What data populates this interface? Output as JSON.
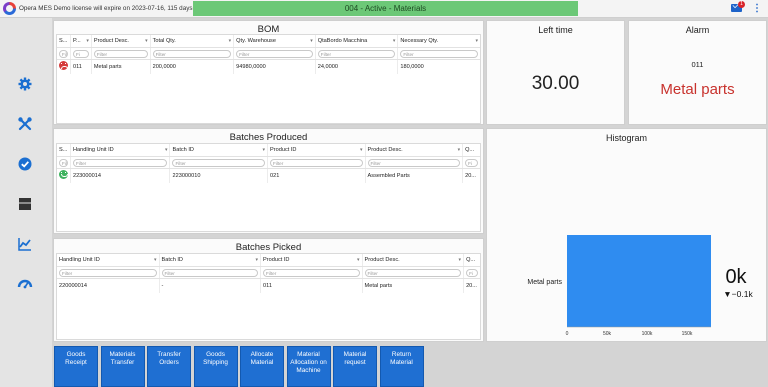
{
  "topbar": {
    "license_text": "Opera MES Demo license will expire on 2023-07-16, 115 days left",
    "status": "004 - Active - Materials",
    "mail_badge": "1",
    "menu_icon": "kebab-menu-icon",
    "logo_icon": "app-logo-icon"
  },
  "sidebar": {
    "icons": [
      "settings-gear-icon",
      "tools-icon",
      "check-circle-icon",
      "package-icon",
      "trend-chart-icon",
      "dashboard-gauge-icon"
    ]
  },
  "bom": {
    "title": "BOM",
    "columns": [
      "S...",
      "P...",
      "Product Desc.",
      "Total Qty.",
      "Qty. Warehouse",
      "QtaBordo Macchina",
      "Necessary Qty."
    ],
    "filter_placeholders": [
      "Filt",
      "Fi",
      "Filter",
      "Filter",
      "Filter",
      "Filter",
      "Filter"
    ],
    "rows": [
      {
        "status": "sad-face-icon",
        "p": "011",
        "desc": "Metal parts",
        "total": "200,0000",
        "warehouse": "94980,0000",
        "machine": "24,0000",
        "necessary": "180,0000"
      }
    ]
  },
  "batches_produced": {
    "title": "Batches Produced",
    "columns": [
      "S...",
      "Handling Unit ID",
      "Batch ID",
      "Product ID",
      "Product Desc.",
      "Q..."
    ],
    "filter_placeholders": [
      "Filt",
      "Filter",
      "Filter",
      "Filter",
      "Filter",
      "Fi"
    ],
    "rows": [
      {
        "status": "happy-face-icon",
        "hu": "223000014",
        "batch": "223000010",
        "product": "021",
        "desc": "Assembled Parts",
        "qty": "20..."
      }
    ]
  },
  "batches_picked": {
    "title": "Batches Picked",
    "columns": [
      "Handling Unit ID",
      "Batch ID",
      "Product ID",
      "Product Desc.",
      "Q..."
    ],
    "filter_placeholders": [
      "Filter",
      "Filter",
      "Filter",
      "Filter",
      "Fi"
    ],
    "rows": [
      {
        "hu": "220000014",
        "batch": "-",
        "product": "011",
        "desc": "Metal parts",
        "qty": "20..."
      }
    ]
  },
  "left_time": {
    "title": "Left time",
    "value": "30.00"
  },
  "alarm": {
    "title": "Alarm",
    "code": "011",
    "text": "Metal parts",
    "color": "#c8322d"
  },
  "histogram": {
    "title": "Histogram",
    "kpi_value": "0k",
    "kpi_delta": "▼−0.1k"
  },
  "chart_data": {
    "type": "bar",
    "orientation": "horizontal",
    "categories": [
      "Metal parts"
    ],
    "values": [
      180000
    ],
    "xlim": [
      0,
      180000
    ],
    "xticks": [
      "0",
      "50k",
      "100k",
      "150k"
    ],
    "xtick_values": [
      0,
      50000,
      100000,
      150000
    ],
    "color": "#2f8cf0",
    "grid": false
  },
  "actions": [
    {
      "label": "Goods Receipt"
    },
    {
      "label": "Materials Transfer"
    },
    {
      "label": "Transfer Orders"
    },
    {
      "label": "Goods Shipping"
    },
    {
      "label": "Allocate Material"
    },
    {
      "label": "Material Allocation on Machine"
    },
    {
      "label": "Material request"
    },
    {
      "label": "Return Material"
    }
  ]
}
